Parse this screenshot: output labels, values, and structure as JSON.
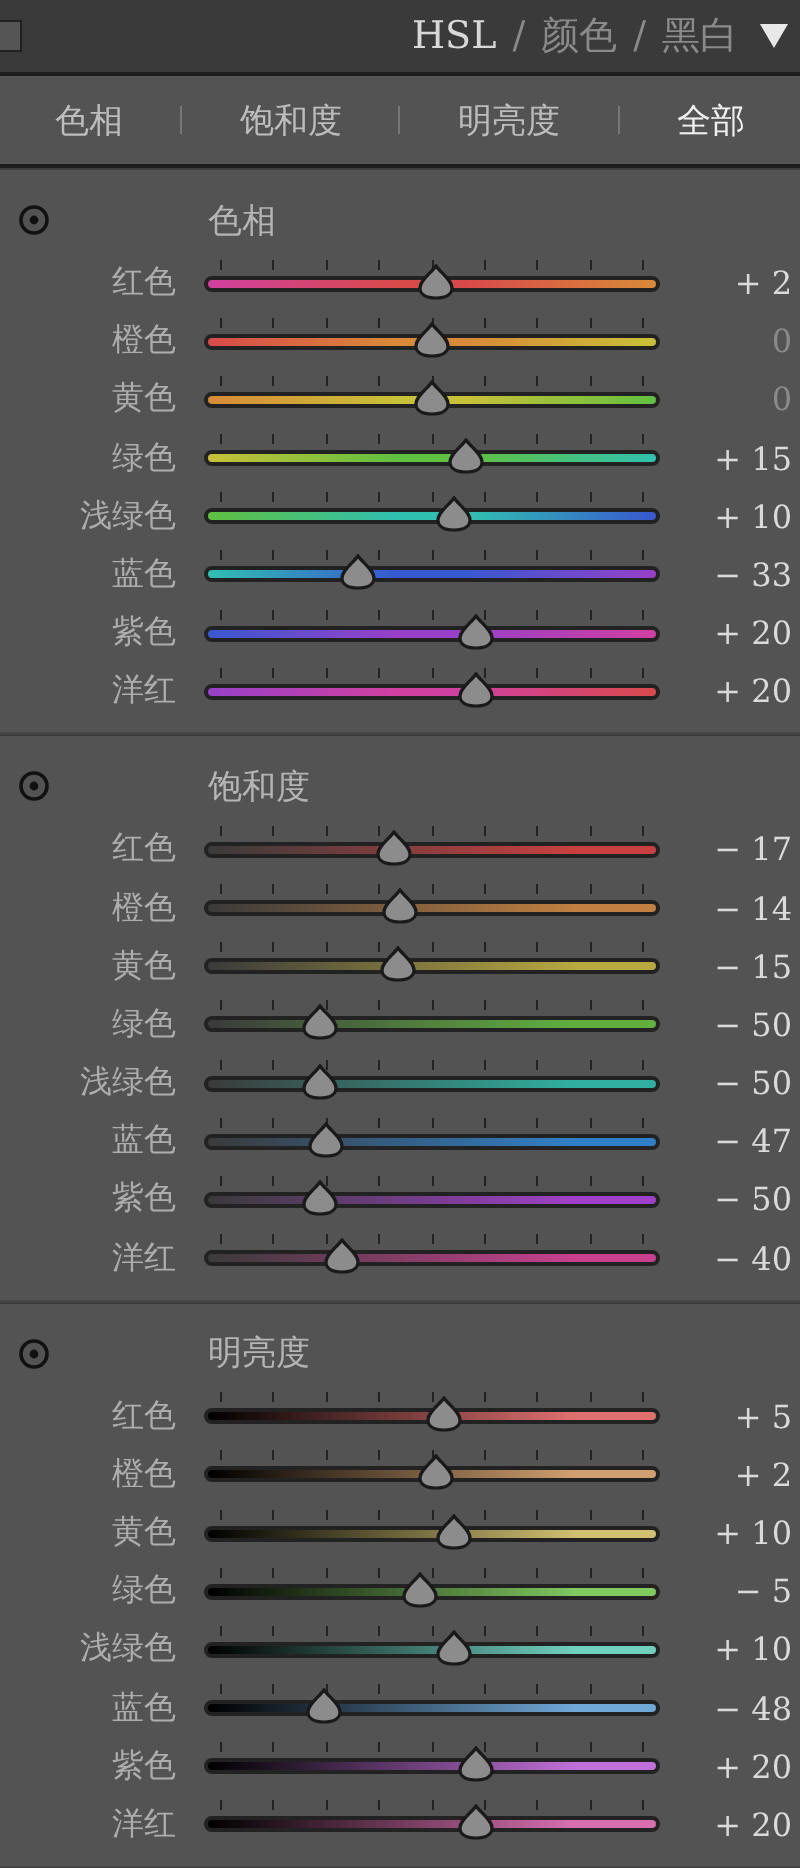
{
  "header": {
    "modes": [
      {
        "label": "HSL",
        "selected": true
      },
      {
        "label": "颜色",
        "selected": false
      },
      {
        "label": "黑白",
        "selected": false
      }
    ],
    "separator": "/"
  },
  "tabs": [
    {
      "label": "色相",
      "selected": false
    },
    {
      "label": "饱和度",
      "selected": false
    },
    {
      "label": "明亮度",
      "selected": false
    },
    {
      "label": "全部",
      "selected": true
    }
  ],
  "sections": [
    {
      "kind": "hue",
      "title": "色相",
      "sliders": [
        {
          "label": "红色",
          "color": "#d84a4a",
          "level": 0.51,
          "reading": "+ 2",
          "modified": true
        },
        {
          "label": "橙色",
          "color": "#d88a38",
          "level": 0.5,
          "reading": "0",
          "modified": false
        },
        {
          "label": "黄色",
          "color": "#c8c038",
          "level": 0.5,
          "reading": "0",
          "modified": false
        },
        {
          "label": "绿色",
          "color": "#60c040",
          "level": 0.575,
          "reading": "+ 15",
          "modified": true
        },
        {
          "label": "浅绿色",
          "color": "#30c0b0",
          "level": 0.55,
          "reading": "+ 10",
          "modified": true
        },
        {
          "label": "蓝色",
          "color": "#3858d0",
          "level": 0.335,
          "reading": "− 33",
          "modified": true
        },
        {
          "label": "紫色",
          "color": "#9840c8",
          "level": 0.6,
          "reading": "+ 20",
          "modified": true
        },
        {
          "label": "洋红",
          "color": "#d040a0",
          "level": 0.6,
          "reading": "+ 20",
          "modified": true
        }
      ]
    },
    {
      "kind": "saturation",
      "title": "饱和度",
      "sliders": [
        {
          "label": "红色",
          "color": "#c84040",
          "level": 0.415,
          "reading": "− 17",
          "modified": true
        },
        {
          "label": "橙色",
          "color": "#c08040",
          "level": 0.43,
          "reading": "− 14",
          "modified": true
        },
        {
          "label": "黄色",
          "color": "#b8a840",
          "level": 0.425,
          "reading": "− 15",
          "modified": true
        },
        {
          "label": "绿色",
          "color": "#60b040",
          "level": 0.25,
          "reading": "− 50",
          "modified": true
        },
        {
          "label": "浅绿色",
          "color": "#30b0a0",
          "level": 0.25,
          "reading": "− 50",
          "modified": true
        },
        {
          "label": "蓝色",
          "color": "#3080c8",
          "level": 0.265,
          "reading": "− 47",
          "modified": true
        },
        {
          "label": "紫色",
          "color": "#a040c8",
          "level": 0.25,
          "reading": "− 50",
          "modified": true
        },
        {
          "label": "洋红",
          "color": "#c84090",
          "level": 0.3,
          "reading": "− 40",
          "modified": true
        }
      ]
    },
    {
      "kind": "luminance",
      "title": "明亮度",
      "sliders": [
        {
          "label": "红色",
          "color": "#e07070",
          "level": 0.525,
          "reading": "+ 5",
          "modified": true
        },
        {
          "label": "橙色",
          "color": "#d0a070",
          "level": 0.51,
          "reading": "+ 2",
          "modified": true
        },
        {
          "label": "黄色",
          "color": "#d0c070",
          "level": 0.55,
          "reading": "+ 10",
          "modified": true
        },
        {
          "label": "绿色",
          "color": "#80c860",
          "level": 0.475,
          "reading": "− 5",
          "modified": true
        },
        {
          "label": "浅绿色",
          "color": "#70d0c0",
          "level": 0.55,
          "reading": "+ 10",
          "modified": true
        },
        {
          "label": "蓝色",
          "color": "#70a8d8",
          "level": 0.26,
          "reading": "− 48",
          "modified": true
        },
        {
          "label": "紫色",
          "color": "#c070d8",
          "level": 0.6,
          "reading": "+ 20",
          "modified": true
        },
        {
          "label": "洋红",
          "color": "#d870b0",
          "level": 0.6,
          "reading": "+ 20",
          "modified": true
        }
      ]
    }
  ]
}
